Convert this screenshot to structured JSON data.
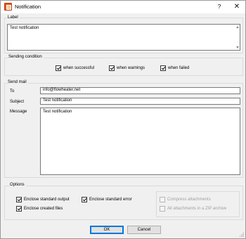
{
  "window": {
    "title": "Notification",
    "help_glyph": "?",
    "close_glyph": "✕"
  },
  "label_group": {
    "title": "Label",
    "value": "Test notification"
  },
  "sending_condition": {
    "title": "Sending condition",
    "options": [
      {
        "label": "when successful",
        "checked": true
      },
      {
        "label": "when warnings",
        "checked": true
      },
      {
        "label": "when failed",
        "checked": true
      }
    ]
  },
  "send_mail": {
    "title": "Send mail",
    "to_label": "To",
    "to_value": "info@flowheater.net",
    "subject_label": "Subject",
    "subject_value": "Test notification",
    "message_label": "Message",
    "message_value": "Test notification"
  },
  "options": {
    "title": "Options",
    "enclose_output": {
      "label": "Enclose standard output",
      "checked": true
    },
    "enclose_error": {
      "label": "Enclose standard error",
      "checked": true
    },
    "enclose_files": {
      "label": "Enclose created files",
      "checked": true
    },
    "compress": {
      "label": "Compress attachments",
      "checked": false,
      "enabled": false
    },
    "zip_archive": {
      "label": "All attachments in a ZIP archive",
      "checked": false,
      "enabled": false
    }
  },
  "buttons": {
    "ok": "OK",
    "cancel": "Cancel"
  },
  "colors": {
    "accent": "#0078d7",
    "app_icon": "#e2571e",
    "disabled_text": "#a0a0a0"
  }
}
